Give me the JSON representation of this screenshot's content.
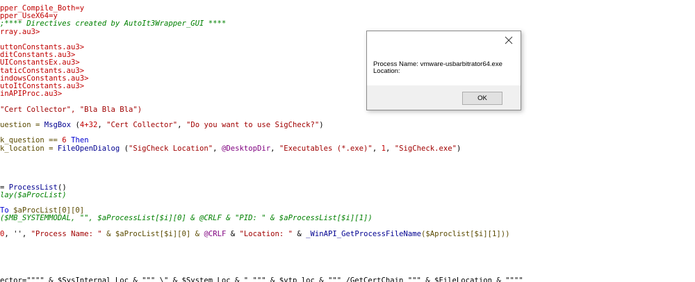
{
  "editor": {
    "lines": [
      [
        {
          "t": "pper_Compile_Both=y",
          "c": "red"
        }
      ],
      [
        {
          "t": "pper_UseX64=y",
          "c": "red"
        }
      ],
      [
        {
          "t": ";**** Directives created by AutoIt3Wrapper_GUI ****",
          "c": "green"
        }
      ],
      [
        {
          "t": "rray.au3>",
          "c": "red"
        }
      ],
      [],
      [
        {
          "t": "uttonConstants.au3>",
          "c": "red"
        }
      ],
      [
        {
          "t": "ditConstants.au3>",
          "c": "red"
        }
      ],
      [
        {
          "t": "UIConstantsEx.au3>",
          "c": "red"
        }
      ],
      [
        {
          "t": "taticConstants.au3>",
          "c": "red"
        }
      ],
      [
        {
          "t": "indowsConstants.au3>",
          "c": "red"
        }
      ],
      [
        {
          "t": "utoItConstants.au3>",
          "c": "red"
        }
      ],
      [
        {
          "t": "inAPIProc.au3>",
          "c": "red"
        }
      ],
      [],
      [
        {
          "t": "\"Cert Collector\", \"Bla Bla Bla\")",
          "c": "str"
        }
      ],
      [],
      [
        {
          "t": "uestion = ",
          "c": "var"
        },
        {
          "t": "MsgBox",
          "c": "fn"
        },
        {
          "t": " (",
          "c": "black"
        },
        {
          "t": "4+32",
          "c": "red"
        },
        {
          "t": ", ",
          "c": "black"
        },
        {
          "t": "\"Cert Collector\"",
          "c": "str"
        },
        {
          "t": ", ",
          "c": "black"
        },
        {
          "t": "\"Do you want to use SigCheck?\"",
          "c": "str"
        },
        {
          "t": ")",
          "c": "black"
        }
      ],
      [],
      [
        {
          "t": "k_question == ",
          "c": "var"
        },
        {
          "t": "6",
          "c": "red"
        },
        {
          "t": " Then",
          "c": "blue"
        }
      ],
      [
        {
          "t": "k_location = ",
          "c": "var"
        },
        {
          "t": "FileOpenDialog",
          "c": "fn"
        },
        {
          "t": " (",
          "c": "black"
        },
        {
          "t": "\"SigCheck Location\"",
          "c": "str"
        },
        {
          "t": ", ",
          "c": "black"
        },
        {
          "t": "@DesktopDir",
          "c": "mac"
        },
        {
          "t": ", ",
          "c": "black"
        },
        {
          "t": "\"Executables (*.exe)\"",
          "c": "str"
        },
        {
          "t": ", ",
          "c": "black"
        },
        {
          "t": "1",
          "c": "red"
        },
        {
          "t": ", ",
          "c": "black"
        },
        {
          "t": "\"SigCheck.exe\"",
          "c": "str"
        },
        {
          "t": ")",
          "c": "black"
        }
      ],
      [],
      [],
      [],
      [],
      [
        {
          "t": "= ",
          "c": "black"
        },
        {
          "t": "ProcessList",
          "c": "fn"
        },
        {
          "t": "()",
          "c": "black"
        }
      ],
      [
        {
          "t": "lay($aProcList)",
          "c": "green"
        }
      ],
      [],
      [
        {
          "t": "To ",
          "c": "blue"
        },
        {
          "t": "$aProcList[0][0]",
          "c": "var"
        }
      ],
      [
        {
          "t": "($MB_SYSTEMMODAL, \"\", $aProcessList[$i][0] & @CRLF & \"PID: \" & $aProcessList[$i][1])",
          "c": "green"
        }
      ],
      [],
      [
        {
          "t": "0",
          "c": "red"
        },
        {
          "t": ", '', ",
          "c": "black"
        },
        {
          "t": "\"Process Name: \"",
          "c": "str"
        },
        {
          "t": " & $aProcList[$i][0] & ",
          "c": "var"
        },
        {
          "t": "@CRLF",
          "c": "mac"
        },
        {
          "t": " & ",
          "c": "black"
        },
        {
          "t": "\"Location: \"",
          "c": "str"
        },
        {
          "t": " & ",
          "c": "black"
        },
        {
          "t": "_WinAPI_GetProcessFileName",
          "c": "fn"
        },
        {
          "t": "($Aproclist[$i][1]))",
          "c": "var"
        }
      ],
      [],
      [],
      [],
      [],
      [],
      [
        {
          "t": "ector=\"\"\"\" & $SysInternal Loc & \"\"\" \\\" & $System Loc & \" \"\"\" & $vtp loc & \"\"\" /GetCertChain \"\"\" & $FileLocation & \"\"\"\"",
          "c": "black"
        }
      ]
    ]
  },
  "dialog": {
    "line1": "Process Name: vmware-usbarbitrator64.exe",
    "line2": "Location:",
    "ok_label": "OK"
  }
}
